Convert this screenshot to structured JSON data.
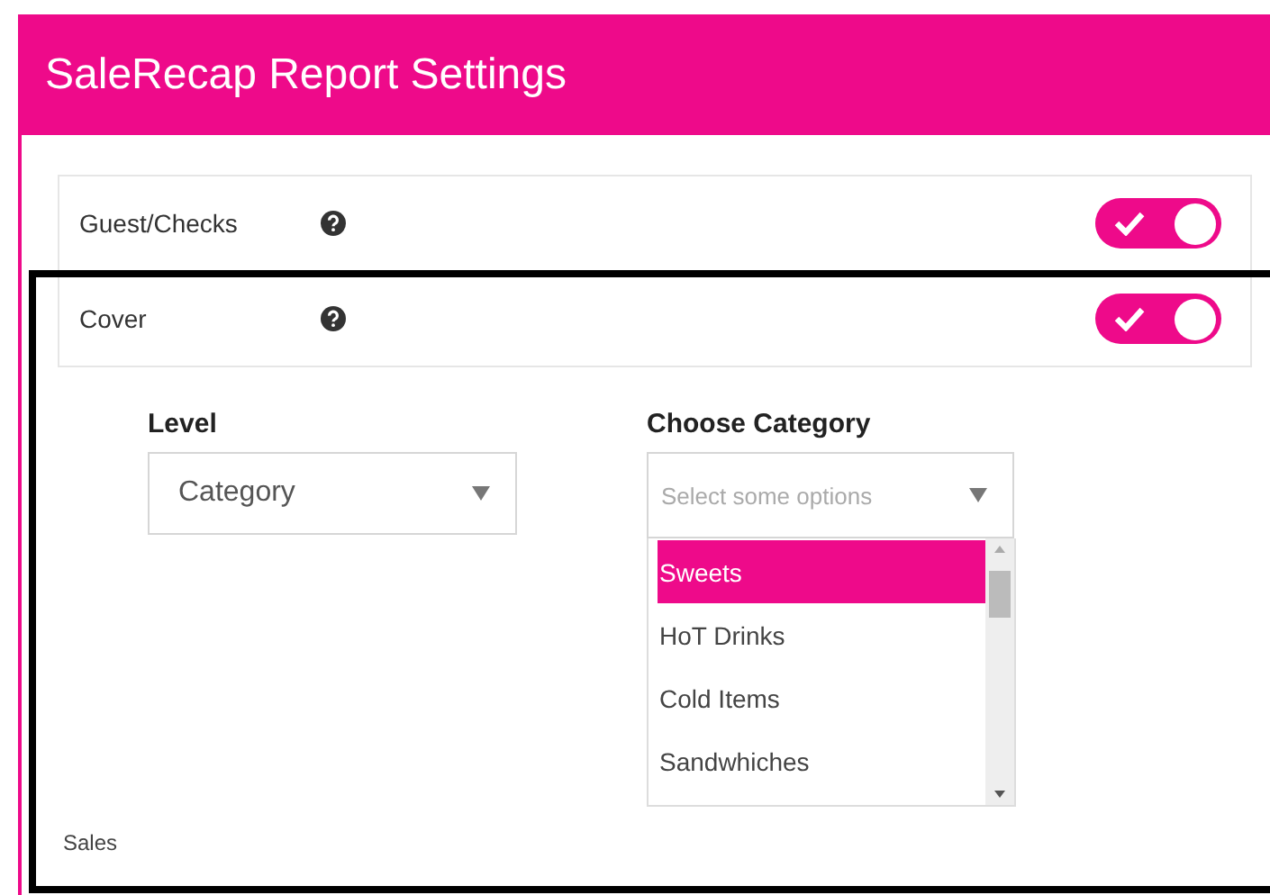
{
  "window": {
    "title": "SaleRecap Report Settings"
  },
  "settings": [
    {
      "label": "Guest/Checks",
      "on": true
    },
    {
      "label": "Cover",
      "on": true
    }
  ],
  "level": {
    "label": "Level",
    "value": "Category"
  },
  "category": {
    "label": "Choose Category",
    "placeholder": "Select some options",
    "options": [
      {
        "label": "Sweets",
        "selected": true
      },
      {
        "label": "HoT Drinks",
        "selected": false
      },
      {
        "label": "Cold Items",
        "selected": false
      },
      {
        "label": "Sandwhiches",
        "selected": false
      }
    ]
  },
  "next_section": {
    "label": "Sales"
  }
}
